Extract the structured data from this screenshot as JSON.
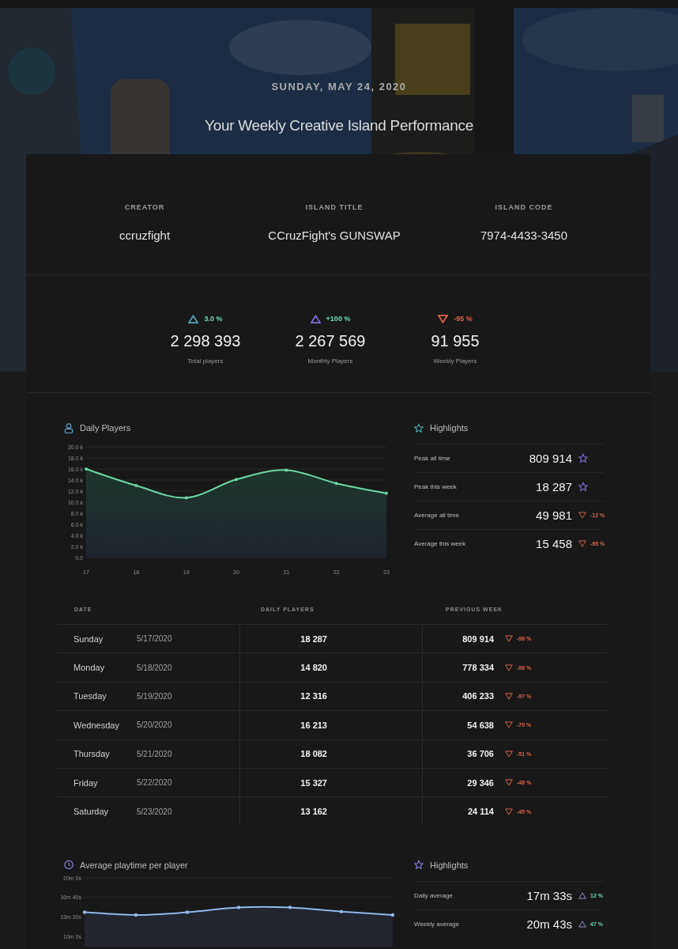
{
  "header": {
    "date": "SUNDAY, MAY 24, 2020",
    "title": "Your Weekly Creative Island Performance"
  },
  "info": [
    {
      "label": "CREATOR",
      "value": "ccruzfight"
    },
    {
      "label": "ISLAND TITLE",
      "value": "CCruzFight's GUNSWAP"
    },
    {
      "label": "ISLAND CODE",
      "value": "7974-4433-3450"
    }
  ],
  "stats": [
    {
      "change": "3.0 %",
      "up": true,
      "color": "#5aa0b4",
      "value": "2 298 393",
      "label": "Total players"
    },
    {
      "change": "+100 %",
      "up": true,
      "color": "#7b6fd0",
      "value": "2 267 569",
      "label": "Monthly Players"
    },
    {
      "change": "-95 %",
      "up": false,
      "color": "#d8664a",
      "value": "91 955",
      "label": "Weekly Players"
    }
  ],
  "daily_chart": {
    "title": "Daily Players",
    "chart_data": {
      "type": "area",
      "grid": true,
      "categories": [
        "17",
        "18",
        "19",
        "20",
        "21",
        "22",
        "23"
      ],
      "ylim": [
        0,
        20000
      ],
      "yticks": [
        {
          "value": 0,
          "label": "0.0"
        },
        {
          "value": 2000,
          "label": "2.0 k"
        },
        {
          "value": 4000,
          "label": "4.0 k"
        },
        {
          "value": 6000,
          "label": "6.0 k"
        },
        {
          "value": 8000,
          "label": "8.0 k"
        },
        {
          "value": 10000,
          "label": "10.0 k"
        },
        {
          "value": 12000,
          "label": "12.0 k"
        },
        {
          "value": 14000,
          "label": "14.0 k"
        },
        {
          "value": 16000,
          "label": "16.0 k"
        },
        {
          "value": 18000,
          "label": "18.0 k"
        },
        {
          "value": 20000,
          "label": "20.0 k"
        }
      ],
      "series": [
        {
          "color": "#6fd6a4",
          "values": [
            16000,
            13000,
            10800,
            14100,
            15800,
            13400,
            11600
          ]
        }
      ]
    }
  },
  "daily_highlights": {
    "title": "Highlights",
    "rows": [
      {
        "label": "Peak all time",
        "value": "809 914",
        "kind": "star"
      },
      {
        "label": "Peak this week",
        "value": "18 287",
        "kind": "star"
      },
      {
        "label": "Average all time",
        "value": "49 981",
        "kind": "change",
        "up": false,
        "change": "-12 %"
      },
      {
        "label": "Average this week",
        "value": "15 458",
        "kind": "change",
        "up": false,
        "change": "-95 %"
      }
    ]
  },
  "table": {
    "columns": [
      "DATE",
      "DAILY PLAYERS",
      "PREVIOUS WEEK"
    ],
    "rows": [
      {
        "day": "Sunday",
        "date": "5/17/2020",
        "daily": "18 287",
        "previous": "809 914",
        "up": false,
        "change": "-98 %"
      },
      {
        "day": "Monday",
        "date": "5/18/2020",
        "daily": "14 820",
        "previous": "778 334",
        "up": false,
        "change": "-98 %"
      },
      {
        "day": "Tuesday",
        "date": "5/19/2020",
        "daily": "12 316",
        "previous": "406 233",
        "up": false,
        "change": "-97 %"
      },
      {
        "day": "Wednesday",
        "date": "5/20/2020",
        "daily": "16 213",
        "previous": "54 638",
        "up": false,
        "change": "-70 %"
      },
      {
        "day": "Thursday",
        "date": "5/21/2020",
        "daily": "18 082",
        "previous": "36 706",
        "up": false,
        "change": "-51 %"
      },
      {
        "day": "Friday",
        "date": "5/22/2020",
        "daily": "15 327",
        "previous": "29 346",
        "up": false,
        "change": "-48 %"
      },
      {
        "day": "Saturday",
        "date": "5/23/2020",
        "daily": "13 162",
        "previous": "24 114",
        "up": false,
        "change": "-45 %"
      }
    ]
  },
  "playtime_chart": {
    "title": "Average playtime per player",
    "axis_labels": [
      "20m 0s",
      "16m 40s",
      "13m 20s",
      "10m 0s"
    ]
  },
  "playtime_highlights": {
    "title": "Highlights",
    "rows": [
      {
        "label": "Daily average",
        "value": "17m 33s",
        "kind": "change",
        "up": true,
        "change": "12 %"
      },
      {
        "label": "Weekly average",
        "value": "20m 43s",
        "kind": "change",
        "up": true,
        "change": "47 %"
      }
    ]
  }
}
